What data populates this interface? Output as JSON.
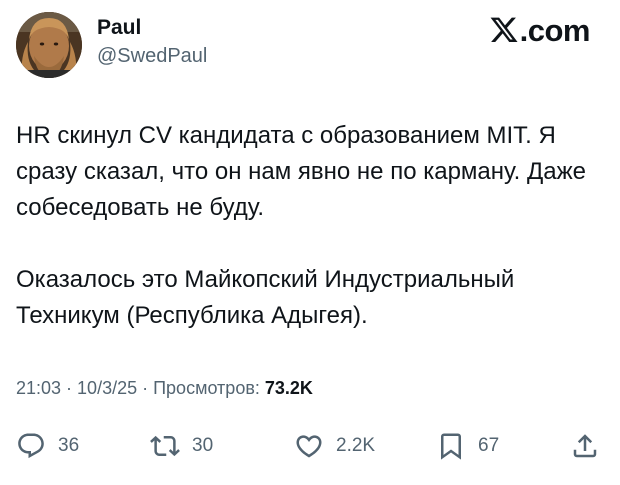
{
  "author": {
    "name": "Paul",
    "handle": "@SwedPaul"
  },
  "brand": {
    "text": ".com",
    "icon": "x-logo-icon"
  },
  "tweet": {
    "paragraphs": [
      "HR скинул CV кандидата с образованием MIT. Я сразу сказал, что он нам явно не по карману. Даже собеседовать не буду.",
      "Оказалось это Майкопский Индустриальный Техникум (Республика Адыгея)."
    ]
  },
  "meta": {
    "time": "21:03",
    "sep1": " · ",
    "date": "10/3/25",
    "sep2": " · ",
    "views_label": "Просмотров: ",
    "views_count": "73.2K"
  },
  "actions": {
    "reply": {
      "count": "36",
      "icon": "reply-icon"
    },
    "repost": {
      "count": "30",
      "icon": "repost-icon"
    },
    "like": {
      "count": "2.2K",
      "icon": "heart-icon"
    },
    "bookmark": {
      "count": "67",
      "icon": "bookmark-icon"
    },
    "share": {
      "icon": "share-icon"
    }
  },
  "colors": {
    "text": "#0f1419",
    "secondary": "#536471",
    "background": "#ffffff"
  }
}
